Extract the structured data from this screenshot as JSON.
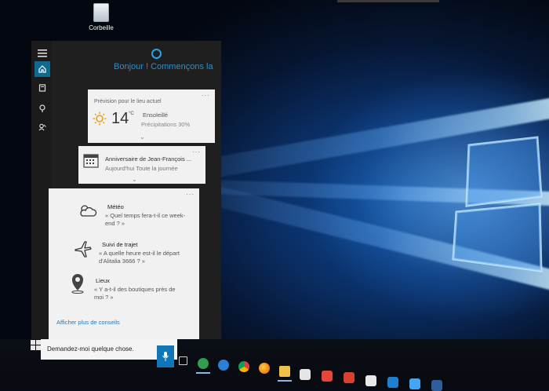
{
  "desktop": {
    "recycle_bin_label": "Corbeille"
  },
  "cortana": {
    "greeting": "Bonjour ! Commençons la",
    "weather_card": {
      "header": "Prévision pour le lieu actuel",
      "temperature": "14",
      "unit": "°C",
      "condition": "Ensoleillé",
      "precipitation": "Précipitations 30%"
    },
    "calendar_card": {
      "title": "Anniversaire de Jean-François ...",
      "subtitle": "Aujourd'hui  Toute la journée"
    },
    "tips": [
      {
        "title": "Météo",
        "text": "« Quel temps fera-t-il ce week-end ? »",
        "icon": "weather-cloud-icon"
      },
      {
        "title": "Suivi de trajet",
        "text": "« A quelle heure est-il le départ d'Alitalia 3666 ? »",
        "icon": "airplane-icon"
      },
      {
        "title": "Lieux",
        "text": "« Y a-t-il des boutiques près de moi ? »",
        "icon": "location-pin-icon"
      }
    ],
    "more_tips": "Afficher plus de conseils"
  },
  "search": {
    "placeholder": "Demandez-moi quelque chose."
  },
  "colors": {
    "accent": "#0f6a92",
    "cortana_blue": "#2ba3e6",
    "card_bg": "#f1f1f1"
  }
}
